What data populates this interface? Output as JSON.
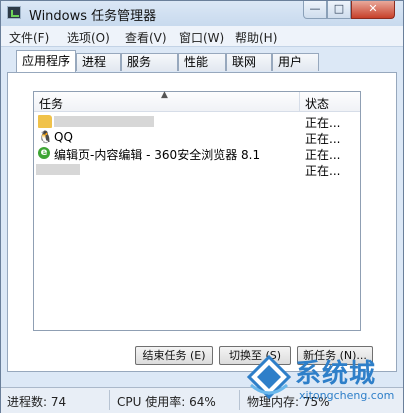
{
  "window": {
    "title": "Windows 任务管理器"
  },
  "controls": {
    "minimize": "—",
    "maximize": "□",
    "close": "✕"
  },
  "menu": [
    "文件(F)",
    "选项(O)",
    "查看(V)",
    "窗口(W)",
    "帮助(H)"
  ],
  "tabs": [
    "应用程序",
    "进程",
    "服务",
    "性能",
    "联网",
    "用户"
  ],
  "active_tab": "应用程序",
  "list": {
    "columns": {
      "task": "任务",
      "status": "状态"
    },
    "rows": [
      {
        "icon": "folder-icon",
        "name": "",
        "status": "正在..."
      },
      {
        "icon": "qq-penguin-icon",
        "name": "QQ",
        "status": "正在..."
      },
      {
        "icon": "360-browser-icon",
        "name": "编辑页-内容编辑 - 360安全浏览器 8.1",
        "status": "正在..."
      },
      {
        "icon": "blurred-icon",
        "name": "",
        "status": "正在..."
      }
    ]
  },
  "buttons": {
    "end_task": "结束任务 (E)",
    "switch_to": "切换至 (S)",
    "new_task": "新任务 (N)..."
  },
  "statusbar": {
    "processes": "进程数: 74",
    "cpu": "CPU 使用率: 64%",
    "memory": "物理内存: 75%"
  },
  "watermark": {
    "text": "系统城",
    "url": "xitongcheng.com"
  },
  "colors": {
    "window_frame": "#dce8f6",
    "close_button": "#c7402a",
    "watermark": "#2e7fc9"
  }
}
